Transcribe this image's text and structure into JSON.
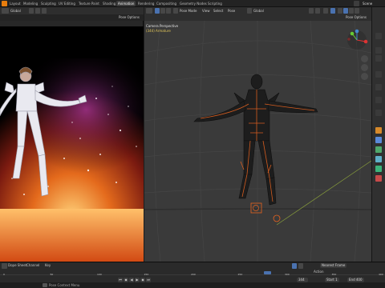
{
  "workspace_tabs": [
    {
      "label": "Layout",
      "active": false
    },
    {
      "label": "Modeling",
      "active": false
    },
    {
      "label": "Sculpting",
      "active": false
    },
    {
      "label": "UV Editing",
      "active": false
    },
    {
      "label": "Texture Paint",
      "active": false
    },
    {
      "label": "Shading",
      "active": false
    },
    {
      "label": "Animation",
      "active": true
    },
    {
      "label": "Rendering",
      "active": false
    },
    {
      "label": "Compositing",
      "active": false
    },
    {
      "label": "Geometry Nodes",
      "active": false
    },
    {
      "label": "Scripting",
      "active": false
    }
  ],
  "scene_label": "Scene",
  "left_editor": {
    "view_menu": "Global",
    "view_options": "Pose Options"
  },
  "viewport": {
    "mode": "Pose Mode",
    "menus": [
      "View",
      "Select",
      "Pose"
    ],
    "transform": "Global",
    "options": "Pose Options",
    "camera_title": "Camera Perspective",
    "camera_sub": "(344) Armature"
  },
  "timeline": {
    "menus": [
      "Dope Sheet",
      "Channel",
      "Key"
    ],
    "keying": "Nearest Frame",
    "active": "Action",
    "current_frame": "344",
    "start_label": "Start",
    "start_value": "1",
    "end_label": "End",
    "end_value": "400",
    "ruler": [
      "0",
      "50",
      "100",
      "150",
      "200",
      "250",
      "300",
      "350",
      "400"
    ]
  },
  "status_text": "Pose Context Menu",
  "colors": {
    "accent_blue": "#4a72b0",
    "selection_orange": "#e8631f",
    "camera_text": "#e5c95a"
  }
}
